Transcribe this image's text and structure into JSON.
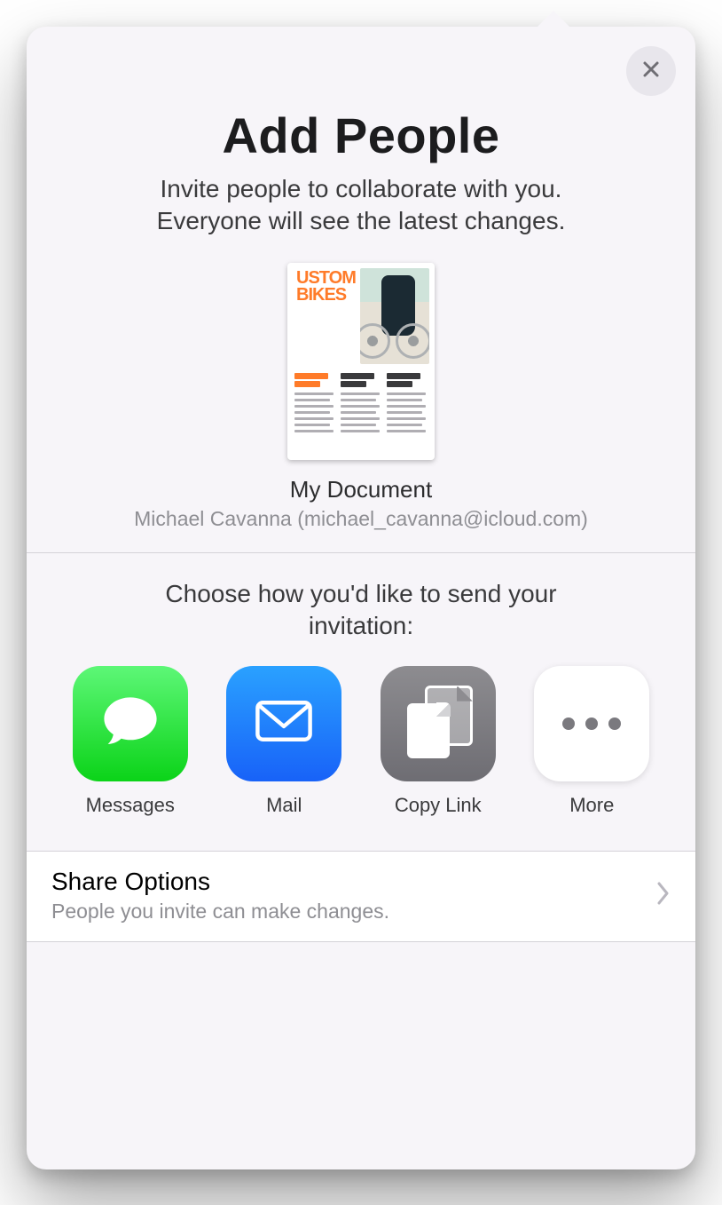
{
  "header": {
    "title": "Add People",
    "subtitle": "Invite people to collaborate with you. Everyone will see the latest changes."
  },
  "document": {
    "thumb_title_line1": "USTOM",
    "thumb_title_line2": "BIKES",
    "name": "My Document",
    "owner": "Michael Cavanna (michael_cavanna@icloud.com)"
  },
  "invite": {
    "choose_label": "Choose how you'd like to send your invitation:"
  },
  "apps": {
    "messages": "Messages",
    "mail": "Mail",
    "copy_link": "Copy Link",
    "more": "More"
  },
  "share_options": {
    "title": "Share Options",
    "subtitle": "People you invite can make changes."
  }
}
